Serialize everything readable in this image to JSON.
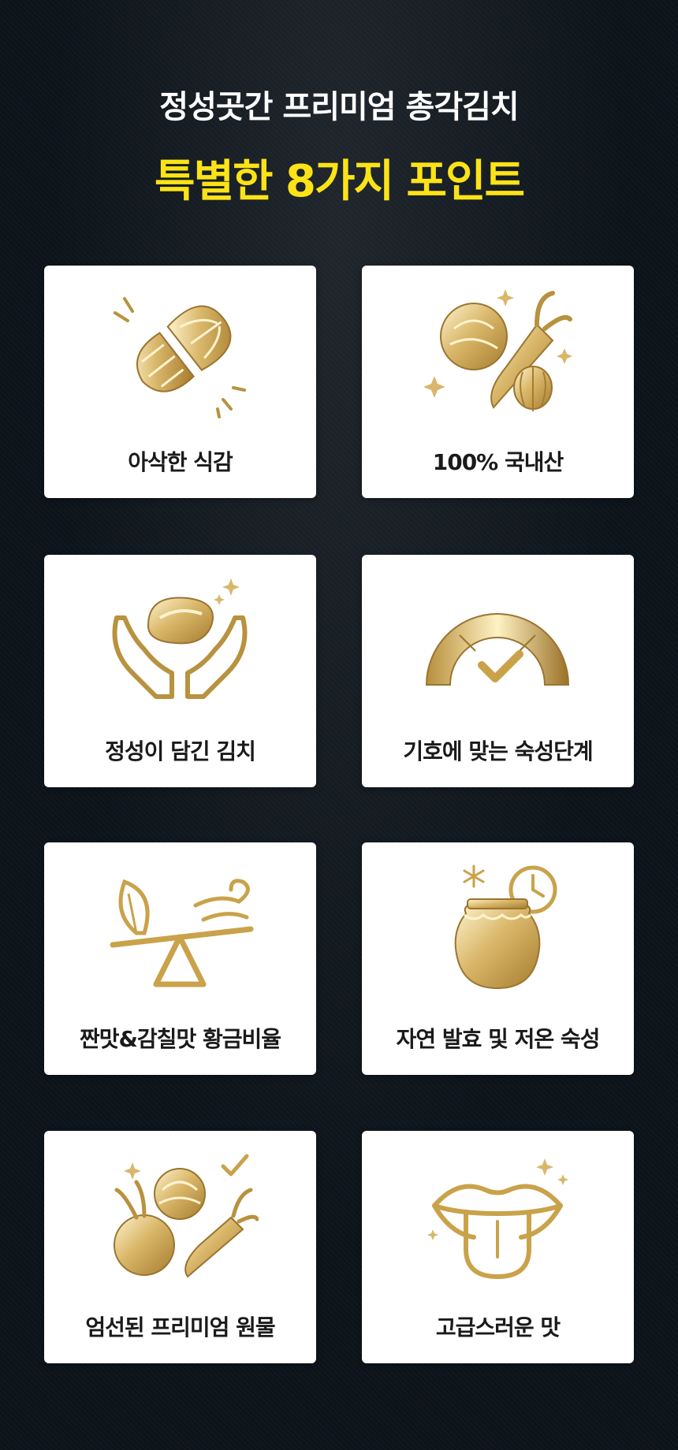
{
  "header": {
    "subtitle": "정성곳간 프리미엄 총각김치",
    "title": "특별한 8가지 포인트"
  },
  "colors": {
    "title": "#fbe317",
    "gold": "#c9a24a",
    "background": "#0d141b"
  },
  "points": [
    {
      "label": "아삭한 식감",
      "icon": "cabbage-crunch-icon"
    },
    {
      "label": "100% 국내산",
      "icon": "vegetables-sparkle-icon"
    },
    {
      "label": "정성이 담긴 김치",
      "icon": "hands-holding-icon"
    },
    {
      "label": "기호에 맞는 숙성단계",
      "icon": "gauge-check-icon"
    },
    {
      "label": "짠맛&감칠맛 황금비율",
      "icon": "balance-seesaw-icon"
    },
    {
      "label": "자연 발효 및 저온 숙성",
      "icon": "jar-clock-snowflake-icon"
    },
    {
      "label": "엄선된 프리미엄 원물",
      "icon": "radish-carrot-cabbage-icon"
    },
    {
      "label": "고급스러운 맛",
      "icon": "lips-tongue-icon"
    }
  ]
}
